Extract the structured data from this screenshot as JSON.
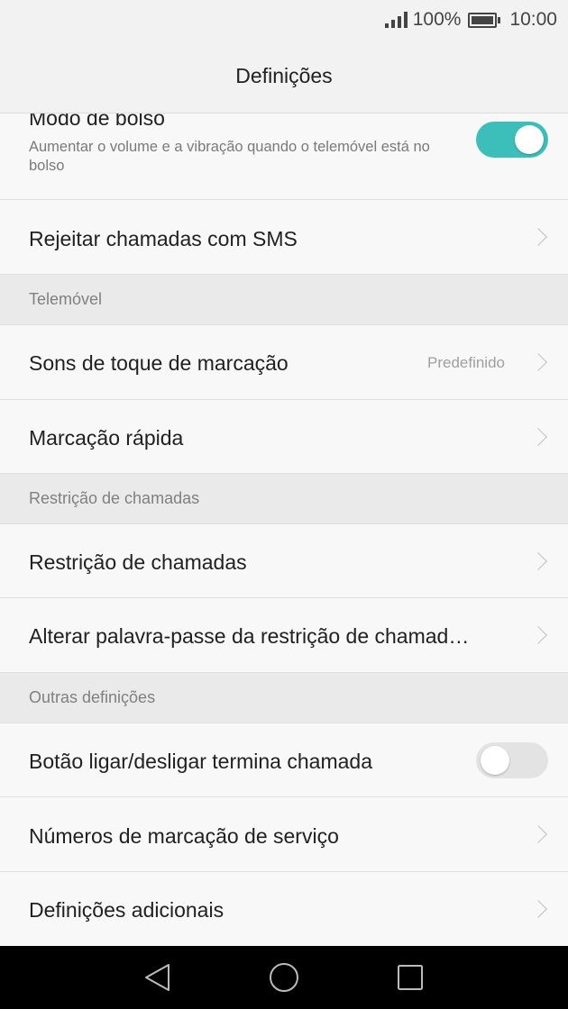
{
  "status_bar": {
    "battery_percent": "100%",
    "time": "10:00",
    "battery_level": 1.0
  },
  "app_bar": {
    "title": "Definições"
  },
  "items": {
    "pocket_mode": {
      "title": "Modo de bolso",
      "subtitle": "Aumentar o volume e a vibração quando o telemóvel está no bolso",
      "toggle_on": true
    },
    "reject_sms": {
      "title": "Rejeitar chamadas com SMS"
    },
    "ringtone": {
      "title": "Sons de toque de marcação",
      "value": "Predefinido"
    },
    "speed_dial": {
      "title": "Marcação rápida"
    },
    "call_barring": {
      "title": "Restrição de chamadas"
    },
    "change_barring_pw": {
      "title": "Alterar palavra-passe da restrição de chamad…"
    },
    "power_ends_call": {
      "title": "Botão ligar/desligar termina chamada",
      "toggle_on": false
    },
    "service_numbers": {
      "title": "Números de marcação de serviço"
    },
    "additional": {
      "title": "Definições adicionais"
    }
  },
  "sections": {
    "phone": "Telemóvel",
    "call_barring": "Restrição de chamadas",
    "other": "Outras definições"
  },
  "nav_bar": {
    "back_icon": "triangle-back-icon",
    "home_icon": "circle-home-icon",
    "recents_icon": "square-recents-icon"
  },
  "colors": {
    "accent": "#3cbfbb",
    "section_bg": "#eaeaea",
    "list_bg": "#f8f8f8",
    "nav_bg": "#000000"
  }
}
